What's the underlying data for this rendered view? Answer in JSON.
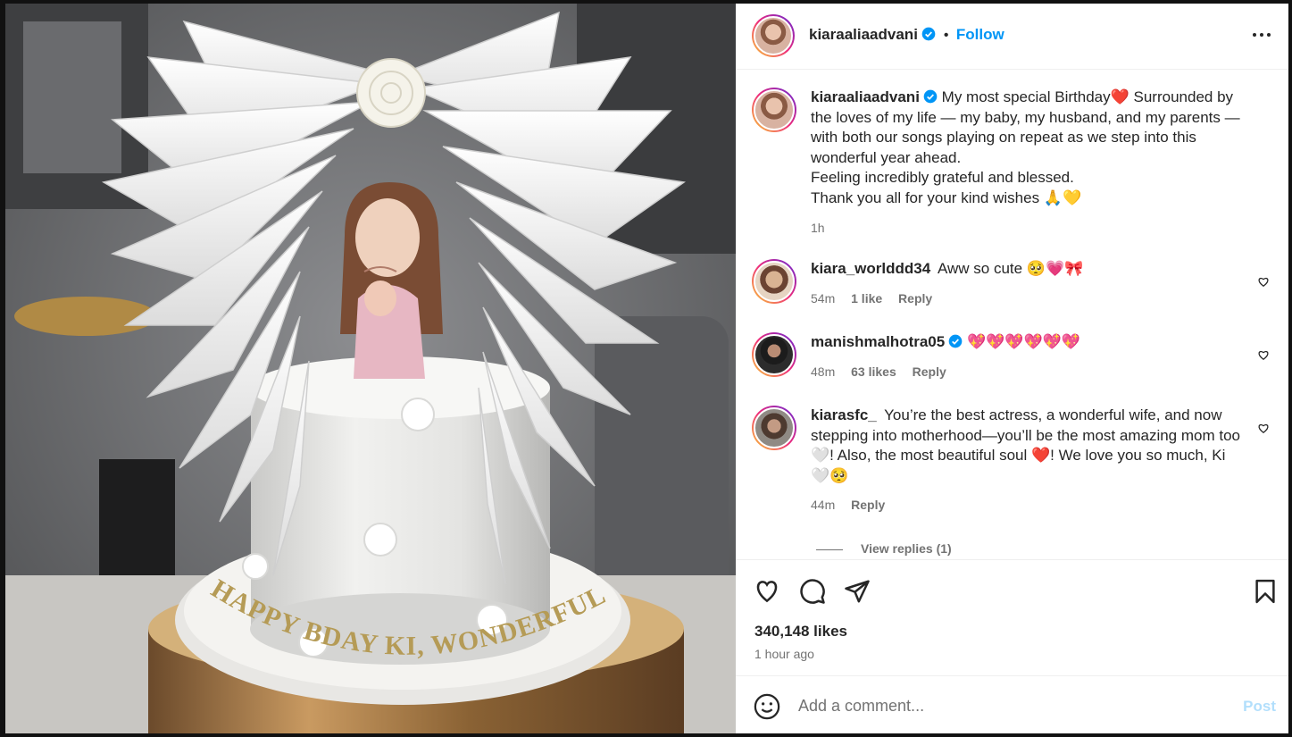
{
  "post": {
    "username": "kiaraaliaadvani",
    "follow_label": "Follow",
    "caption": {
      "username": "kiaraaliaadvani",
      "line1": "My most special Birthday",
      "line1_emoji": "❤️",
      "line1_rest": " Surrounded by the loves of my life — my baby, my husband, and my parents — with both our songs playing on repeat as we step into this wonderful year ahead.",
      "line2": "Feeling incredibly grateful and blessed.",
      "line3": "Thank you all for your kind wishes",
      "line3_emoji_pray": "🙏",
      "line3_emoji_heart": "💛",
      "time": "1h"
    },
    "cake_text": "HAPPY BDAY KI, WONDERFUL MAMA!"
  },
  "comments": [
    {
      "username": "kiara_worlddd34",
      "text": "Aww so cute 🥺💗🎀",
      "time": "54m",
      "likes": "1 like",
      "reply": "Reply"
    },
    {
      "username": "manishmalhotra05",
      "verified": true,
      "text": "💖💖💖💖💖💖",
      "time": "48m",
      "likes": "63 likes",
      "reply": "Reply"
    },
    {
      "username": "kiarasfc_",
      "text": "You’re the best actress, a wonderful wife, and now stepping into motherhood—you’ll be the most amazing mom too 🤍! Also, the most beautiful soul ❤️! We love you so much, Ki 🤍🥺",
      "time": "44m",
      "reply": "Reply",
      "view_replies": "View replies (1)"
    }
  ],
  "footer": {
    "likes": "340,148 likes",
    "time": "1 hour ago",
    "comment_placeholder": "Add a comment...",
    "post_label": "Post"
  },
  "icons": {
    "like": "heart-icon",
    "comment": "comment-icon",
    "share": "share-icon",
    "save": "bookmark-icon",
    "emoji": "emoji-icon",
    "more": "more-icon",
    "verified": "verified-badge-icon"
  },
  "colors": {
    "link_blue": "#0095f6",
    "post_disabled": "#b2dffc",
    "secondary_text": "#737373"
  }
}
